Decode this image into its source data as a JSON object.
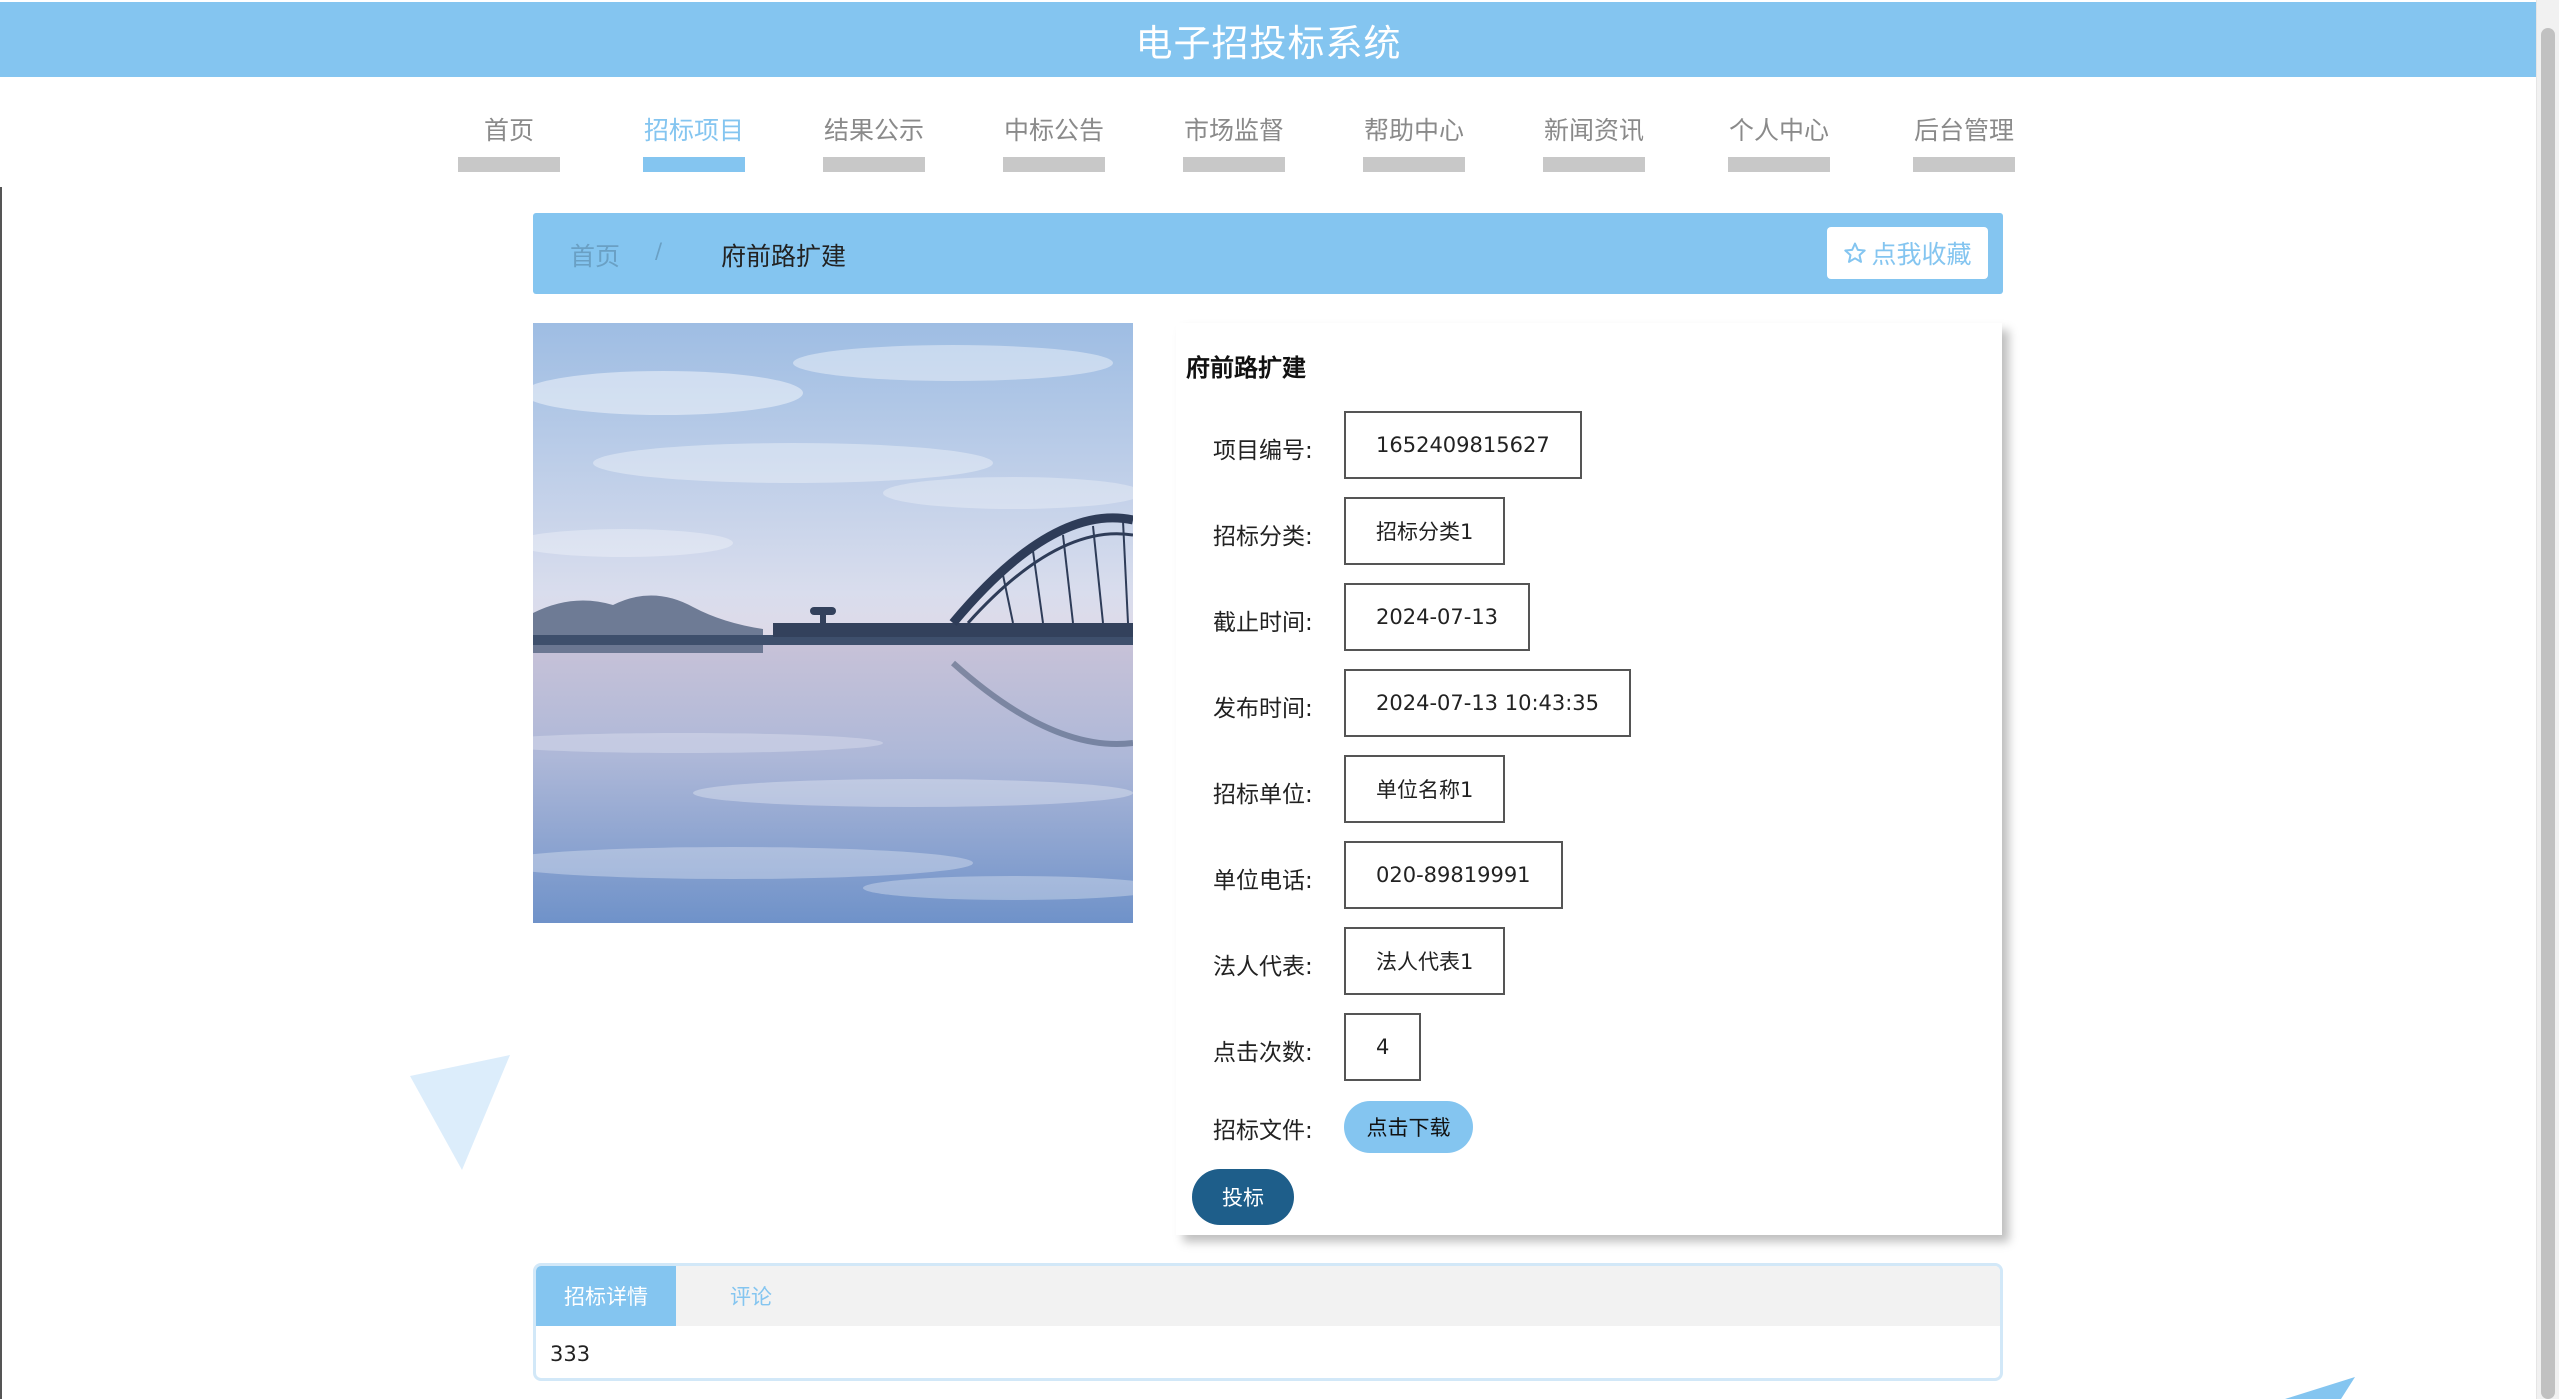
{
  "app_title": "电子招投标系统",
  "nav": {
    "items": [
      {
        "label": "首页"
      },
      {
        "label": "招标项目",
        "active": true
      },
      {
        "label": "结果公示"
      },
      {
        "label": "中标公告"
      },
      {
        "label": "市场监督"
      },
      {
        "label": "帮助中心"
      },
      {
        "label": "新闻资讯"
      },
      {
        "label": "个人中心"
      },
      {
        "label": "后台管理"
      }
    ]
  },
  "breadcrumb": {
    "home": "首页",
    "separator": "/",
    "current": "府前路扩建"
  },
  "favorite": {
    "icon": "star-outline-icon",
    "label": "点我收藏"
  },
  "project": {
    "title": "府前路扩建",
    "fields": [
      {
        "label": "项目编号:",
        "value": "1652409815627"
      },
      {
        "label": "招标分类:",
        "value": "招标分类1"
      },
      {
        "label": "截止时间:",
        "value": "2024-07-13"
      },
      {
        "label": "发布时间:",
        "value": "2024-07-13 10:43:35"
      },
      {
        "label": "招标单位:",
        "value": "单位名称1"
      },
      {
        "label": "单位电话:",
        "value": "020-89819991"
      },
      {
        "label": "法人代表:",
        "value": "法人代表1"
      },
      {
        "label": "点击次数:",
        "value": "4"
      }
    ],
    "file_label": "招标文件:",
    "download_label": "点击下载",
    "bid_label": "投标"
  },
  "tabs": {
    "items": [
      {
        "label": "招标详情",
        "active": true
      },
      {
        "label": "评论"
      }
    ],
    "content": "333"
  },
  "colors": {
    "primary": "#84c5f0",
    "dark_button": "#1e5e8a",
    "nav_underline": "#c8c8c8"
  }
}
